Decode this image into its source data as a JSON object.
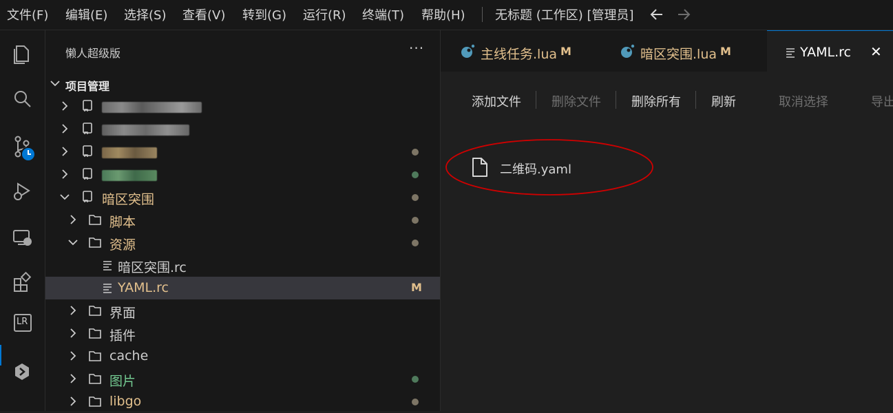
{
  "menu": {
    "items": [
      "文件(F)",
      "编辑(E)",
      "选择(S)",
      "查看(V)",
      "转到(G)",
      "运行(R)",
      "终端(T)",
      "帮助(H)"
    ],
    "window_title": "无标题 (工作区) [管理员]"
  },
  "activity_bar": {
    "icons": [
      "explorer-icon",
      "search-icon",
      "source-control-icon",
      "run-debug-icon",
      "remote-explorer-icon",
      "extensions-icon",
      "lr-icon",
      "plugin-icon"
    ],
    "lr_label": "LR"
  },
  "sidebar": {
    "title": "懒人超级版",
    "more": "···",
    "section_title": "项目管理",
    "tree": [
      {
        "label": "",
        "type": "project",
        "redacted": true,
        "status": ""
      },
      {
        "label": "",
        "type": "project",
        "redacted": true,
        "status": ""
      },
      {
        "label": "",
        "type": "project",
        "redacted": true,
        "status": "modified-dot"
      },
      {
        "label": "",
        "type": "project",
        "redacted": true,
        "status": "added-dot"
      },
      {
        "label": "暗区突围",
        "type": "project",
        "expanded": true,
        "status": "modified-dot"
      },
      {
        "label": "脚本",
        "type": "folder",
        "status": "modified-dot"
      },
      {
        "label": "资源",
        "type": "folder",
        "expanded": true,
        "status": "modified-dot"
      },
      {
        "label": "暗区突围.rc",
        "type": "file",
        "status": ""
      },
      {
        "label": "YAML.rc",
        "type": "file",
        "selected": true,
        "status": "M"
      },
      {
        "label": "界面",
        "type": "folder",
        "status": ""
      },
      {
        "label": "插件",
        "type": "folder",
        "status": ""
      },
      {
        "label": "cache",
        "type": "folder",
        "status": ""
      },
      {
        "label": "图片",
        "type": "folder",
        "status": "added-dot"
      },
      {
        "label": "libgo",
        "type": "folder",
        "status": "modified-dot"
      }
    ]
  },
  "tabs": [
    {
      "label": "主线任务.lua",
      "badge": "M",
      "active": false
    },
    {
      "label": "暗区突围.lua",
      "badge": "M",
      "active": false
    },
    {
      "label": "YAML.rc",
      "badge": "",
      "active": true,
      "close": "✕"
    }
  ],
  "editor": {
    "toolbar": [
      "添加文件",
      "删除文件",
      "删除所有",
      "刷新",
      "取消选择",
      "导出"
    ],
    "files": [
      "二维码.yaml"
    ]
  },
  "colors": {
    "accent": "#0078d4",
    "modified": "#e2c08d",
    "added": "#73c991",
    "annotation_circle": "#d00000"
  }
}
